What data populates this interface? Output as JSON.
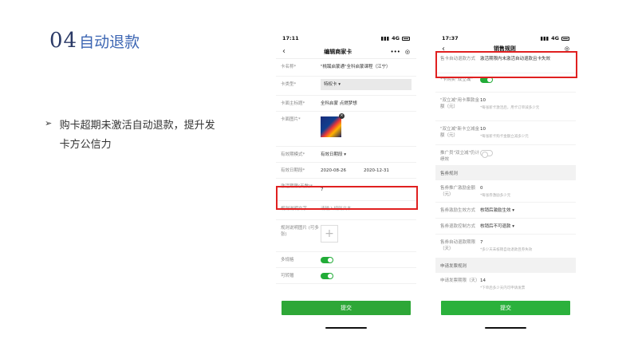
{
  "slide": {
    "number": "04",
    "title": "自动退款",
    "bullet_marker": "➢",
    "bullet_text": "购卡超期未激活自动退款，提升发卡方公信力"
  },
  "phone1": {
    "time": "17:11",
    "signal": "4G",
    "nav_title": "编辑商家卡",
    "rows": {
      "card_name_label": "卡名称*",
      "card_name_value": "\"桃蹊启蒙通\"全科启蒙课程（江宁）",
      "card_type_label": "卡类型*",
      "card_type_value": "特权卡 ▾",
      "main_title_label": "卡面主标题*",
      "main_title_value": "全科启蒙 点燃梦想",
      "image_label": "卡面图片*",
      "validity_mode_label": "有效期模式*",
      "validity_mode_value": "有效日期段 ▾",
      "date_range_label": "有效日期段*",
      "date_start": "2020-08-26",
      "date_end": "2020-12-31",
      "activation_label": "激活期限(天数)*",
      "activation_value": "7",
      "rule_text_label": "规则说明文字",
      "rule_text_placeholder": "请输入规则文本",
      "rule_image_label": "规则说明图片 (可多张)",
      "multi_spec_label": "多规格",
      "transferable_label": "可转赠"
    },
    "submit": "提交"
  },
  "phone2": {
    "time": "17:37",
    "signal": "4G",
    "nav_title": "销售规则",
    "rows": {
      "expire_label": "售卡自动退款方式",
      "expire_value": "激活期限内未激活自动退款且卡失效",
      "dual_label": "*卡购卖\"双立减\"",
      "dual_card_label": "\"双立减\"用卡票款金额（元）",
      "dual_card_value": "10",
      "dual_card_hint": "*每张新卡激活后，用卡订单减多少元",
      "dual_new_label": "\"双立减\"新卡立减金额（元）",
      "dual_new_value": "10",
      "dual_new_hint": "*每张新卡购卡金额立减多少元",
      "promoter_label": "推广员\"双立减\"仍计绩效"
    },
    "section_voucher": "售券规则",
    "voucher": {
      "reward_label": "售券推广激励金额（元）",
      "reward_value": "0",
      "reward_hint": "*每张券激励多少元",
      "effect_label": "售券激励生效方式",
      "effect_value": "核销后激励生效 ▾",
      "refund_label": "售券退款控制方式",
      "refund_value": "核销后不可退款 ▾",
      "refund_days_label": "售券自动退款期限（天）",
      "refund_days_value": "7",
      "refund_days_hint": "*多少天未核销自动退款且券失效"
    },
    "section_invoice": "申请发票规则",
    "invoice": {
      "label": "申请发票期限（天）",
      "value": "14",
      "hint": "*下单后多少天内可申请发票"
    },
    "submit": "提交"
  }
}
